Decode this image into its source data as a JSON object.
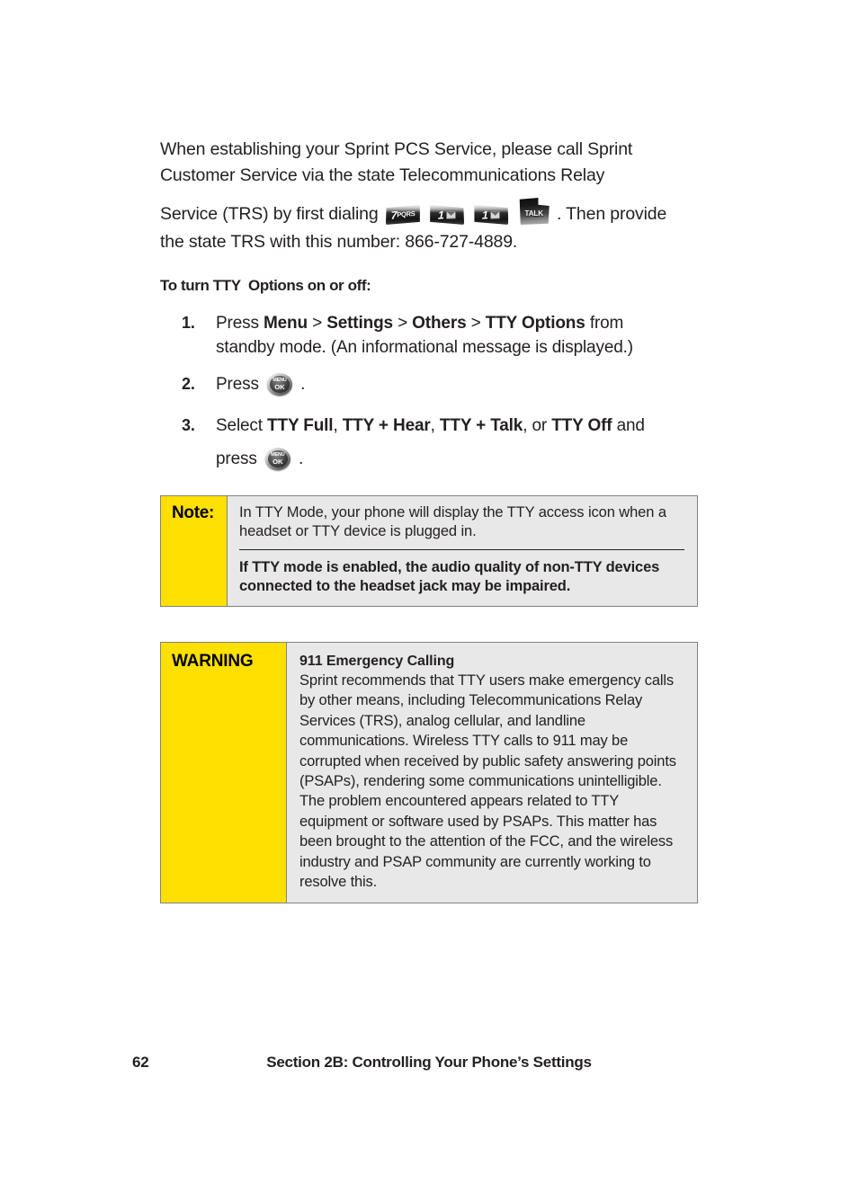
{
  "document": {
    "intro": {
      "line1": "When establishing your Sprint PCS Service, please call Sprint",
      "line2": "Customer Service via the state Telecommunications Relay",
      "line3_before": "Service (TRS) by first dialing",
      "line3_after": ". Then provide",
      "line4": "the state TRS with this number: 866-727-4889."
    },
    "keys": {
      "key_7": {
        "digit": "7",
        "sub": "PQRS",
        "name": "key-7-pqrs"
      },
      "key_1a": {
        "digit": "1",
        "sub": "voicemail",
        "name": "key-1-voicemail"
      },
      "key_1b": {
        "digit": "1",
        "sub": "voicemail",
        "name": "key-1-voicemail"
      },
      "key_talk": {
        "label": "TALK",
        "name": "key-talk"
      },
      "key_menu_ok": {
        "top": "MENU",
        "bottom": "OK",
        "name": "key-menu-ok"
      }
    },
    "procedure": {
      "heading": "To turn TTY  Options on or off:",
      "steps": [
        {
          "num": "1.",
          "pre": "Press ",
          "b1": "Menu",
          "sep1": " > ",
          "b2": "Settings",
          "sep2": " > ",
          "b3": "Others",
          "sep3": " > ",
          "b4": "TTY Options",
          "post": " from",
          "line2": "standby mode. (An informational message is displayed.)"
        },
        {
          "num": "2.",
          "pre": "Press ",
          "post": " ."
        },
        {
          "num": "3.",
          "pre": "Select ",
          "b1": "TTY Full",
          "sep1": ", ",
          "b2": "TTY + Hear",
          "sep2": ", ",
          "b3": "TTY + Talk",
          "sep3": ", or ",
          "b4": "TTY Off",
          "post": " and",
          "line2_pre": "press ",
          "line2_post": " ."
        }
      ]
    },
    "note": {
      "tag": "Note:",
      "paragraph1": "In TTY Mode, your phone will display the TTY access icon when a headset or TTY device is plugged in.",
      "paragraph2": "If TTY mode is enabled, the audio quality of non-TTY devices connected to the headset jack may be impaired."
    },
    "warning": {
      "tag": "WARNING",
      "title": "911 Emergency Calling",
      "text": "Sprint recommends that TTY users make emergency calls by other means, including Telecommunications Relay Services (TRS), analog cellular, and landline communications. Wireless TTY calls to 911 may be corrupted when received by public safety answering points (PSAPs), rendering some communications unintelligible. The problem encountered appears related to TTY equipment or software used by PSAPs. This matter has been brought to the attention of the FCC, and the wireless industry and PSAP community are currently working to resolve this."
    },
    "footer": {
      "page_number": "62",
      "section_title": "Section 2B: Controlling Your Phone’s Settings"
    },
    "colors": {
      "tag_yellow": "#FFE000",
      "callout_background": "#E8E8E8",
      "callout_border": "#808285",
      "text": "#231F20"
    }
  }
}
